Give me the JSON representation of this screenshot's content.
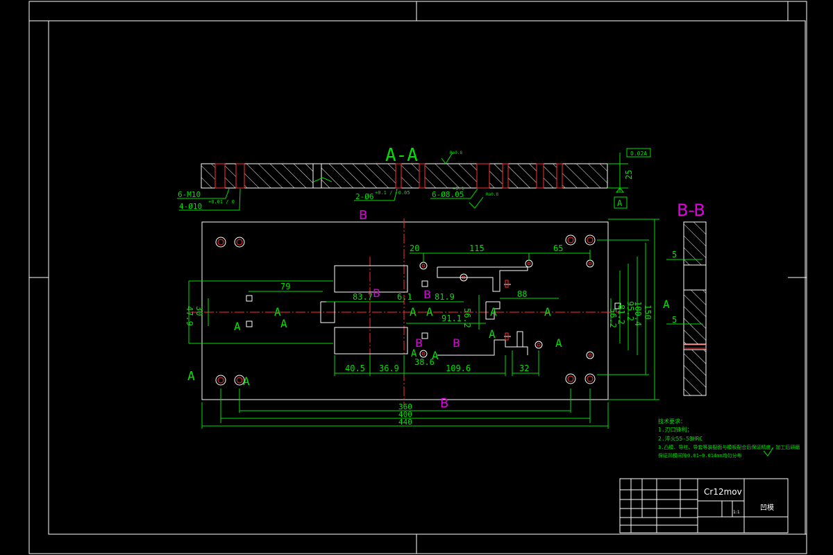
{
  "section_aa": {
    "title": "A-A",
    "flatness": "0.02A",
    "roughness": "Ra0.8",
    "datum": "A",
    "thickness": "25"
  },
  "section_aa_callouts": {
    "tapped": "6-M10",
    "pin_holes": "2-Ø6",
    "pin_tol": "+0.1 / -0.05",
    "holes6": "6-Ø8.05",
    "holes6_tol": "+0.1",
    "counterbore": "4-Ø10",
    "counterbore_tol": "+0.01 / 0"
  },
  "plan_dims": {
    "d360": "360",
    "d400": "400",
    "d440": "440",
    "d20": "20",
    "d115": "115",
    "d65": "65",
    "d79": "79",
    "d88": "88",
    "d83_7": "83.7",
    "d6_1": "6.1",
    "d81_9": "81.9",
    "d91_1": "91.1",
    "d56_2a": "56.2",
    "d40_5": "40.5",
    "d36_9": "36.9",
    "d38_6": "38.6",
    "d109_6": "109.6",
    "d32": "32",
    "d56_2b": "56.2",
    "d81_2": "81.2",
    "d95_2": "95.2",
    "d100_4": "100.4",
    "d150": "150",
    "d47_9": "47.9",
    "d30": "30"
  },
  "section_labels": {
    "a": "A",
    "b": "B",
    "bb": "B-B"
  },
  "section_bb": {
    "title": "B-B",
    "dim_top": "5",
    "dim_bottom": "5"
  },
  "tech_notes": {
    "heading": "技术要求：",
    "n1": "1.刃口锋利；",
    "n2": "2.淬火55-58HRC",
    "n3": "3.凸模、导柱、导套等装配面与模板配合后保证精度，加工后研磨",
    "n4": "保证凹模间隙0.01~0.014mm均匀分布"
  },
  "title_block": {
    "material": "Cr12mov",
    "part_name": "凹模",
    "scale": "1:1"
  }
}
